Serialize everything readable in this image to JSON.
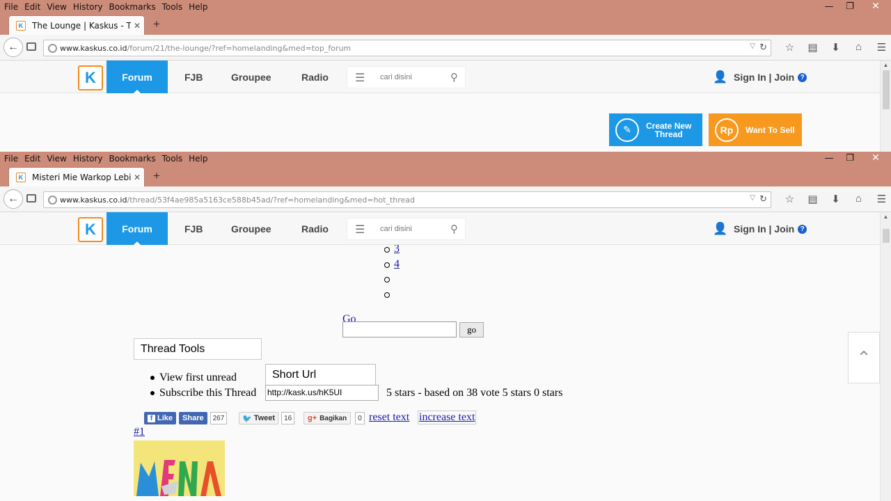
{
  "menu": [
    "File",
    "Edit",
    "View",
    "History",
    "Bookmarks",
    "Tools",
    "Help"
  ],
  "window_controls": {
    "minimize": "—",
    "restore": "❐",
    "close": "✕"
  },
  "window1": {
    "tab_title": "The Lounge | Kaskus - The ...",
    "url_host": "www.kaskus.co.id",
    "url_path": "/forum/21/the-lounge/?ref=homelanding&med=top_forum"
  },
  "window2": {
    "tab_title": "Misteri Mie Warkop Lebih ...",
    "url_host": "www.kaskus.co.id",
    "url_path": "/thread/53f4ae985a5163ce588b45ad/?ref=homelanding&med=hot_thread"
  },
  "site_nav": {
    "logo": "K",
    "items": [
      "Forum",
      "FJB",
      "Groupee",
      "Radio"
    ],
    "search_placeholder": "cari disini",
    "sign_in": "Sign In | Join",
    "help": "?"
  },
  "actions": {
    "create_line1": "Create New",
    "create_line2": "Thread",
    "sell": "Want To Sell",
    "sell_icon": "Rp"
  },
  "thread": {
    "pages": [
      "3",
      "4"
    ],
    "go_link": "Go",
    "go_button": "go",
    "thread_tools": "Thread Tools",
    "tools_items": [
      "View first unread",
      "Subscribe this Thread"
    ],
    "short_url_label": "Short Url",
    "short_url_value": "http://kask.us/hK5UI",
    "rating_text": "5 stars - based on 38 vote 5 stars 0 stars",
    "fb_like": "Like",
    "fb_share": "Share",
    "fb_count": "267",
    "tweet": "Tweet",
    "tweet_count": "16",
    "bagikan": "Bagikan",
    "bagikan_count": "0",
    "reset_text": "reset text",
    "increase_text": "increase text",
    "post_number": "#1",
    "back_to_top": "⌃"
  }
}
